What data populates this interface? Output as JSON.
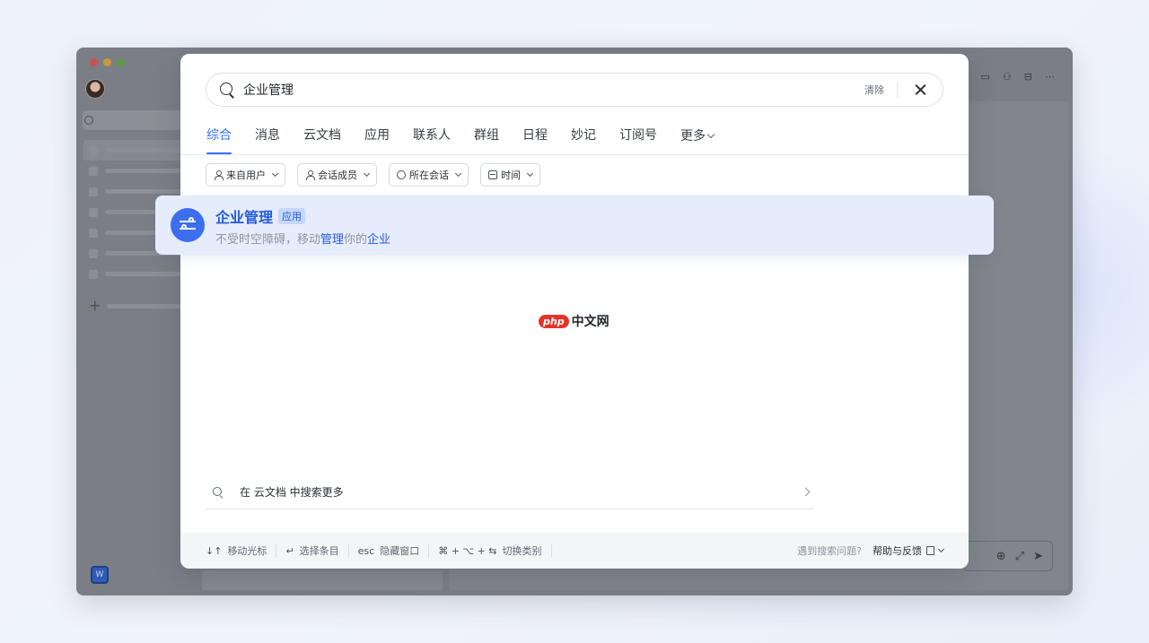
{
  "search": {
    "query": "企业管理",
    "clear_label": "清除"
  },
  "tabs": [
    {
      "label": "综合",
      "active": true
    },
    {
      "label": "消息"
    },
    {
      "label": "云文档"
    },
    {
      "label": "应用"
    },
    {
      "label": "联系人"
    },
    {
      "label": "群组"
    },
    {
      "label": "日程"
    },
    {
      "label": "妙记"
    },
    {
      "label": "订阅号"
    },
    {
      "label": "更多"
    }
  ],
  "filters": [
    {
      "label": "来自用户",
      "icon": "user-icon"
    },
    {
      "label": "会话成员",
      "icon": "user-icon"
    },
    {
      "label": "所在会话",
      "icon": "chat-icon"
    },
    {
      "label": "时间",
      "icon": "calendar-icon"
    }
  ],
  "result": {
    "name": "企业管理",
    "tag": "应用",
    "desc_parts": [
      "不受时空障碍，移动",
      "管理",
      "你的",
      "企业"
    ],
    "accent": "#3370ff"
  },
  "watermark": {
    "badge": "php",
    "text": "中文网"
  },
  "search_more": {
    "text": "在 云文档 中搜索更多"
  },
  "footer": {
    "hints": [
      {
        "key": "↓↑",
        "label": "移动光标"
      },
      {
        "key": "↵",
        "label": "选择条目"
      },
      {
        "key": "esc",
        "label": "隐藏窗口"
      },
      {
        "key": "⌘ + ⌥ + ⇆",
        "label": "切换类别"
      }
    ],
    "problem": "遇到搜索问题?",
    "feedback": "帮助与反馈"
  },
  "background_app": {
    "workspace_badge": "W"
  }
}
